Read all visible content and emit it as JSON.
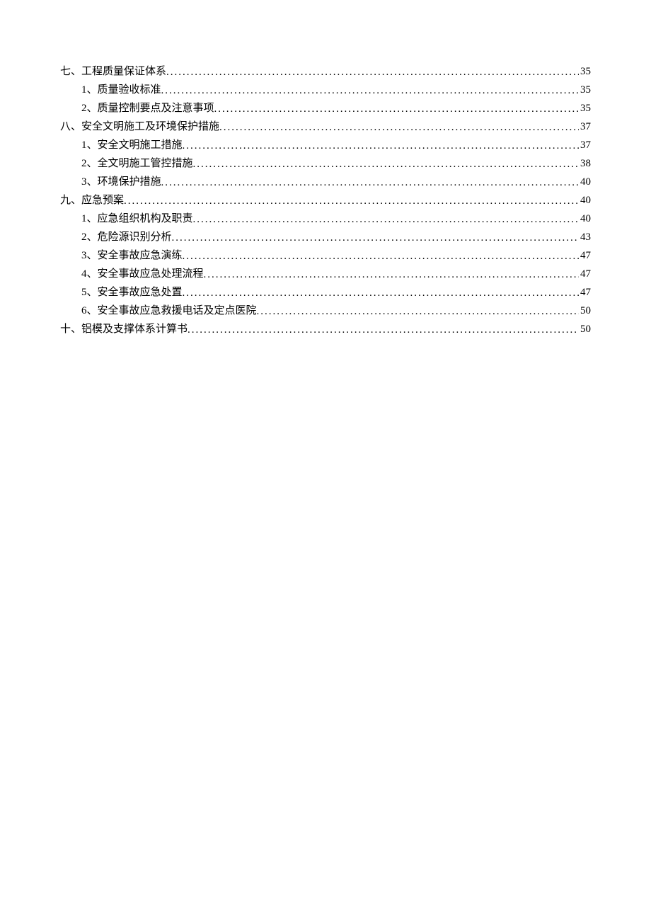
{
  "toc": [
    {
      "level": 1,
      "label": "七、工程质量保证体系",
      "page": "35"
    },
    {
      "level": 2,
      "label": "1、质量验收标准",
      "page": "35"
    },
    {
      "level": 2,
      "label": "2、质量控制要点及注意事项",
      "page": "35"
    },
    {
      "level": 1,
      "label": "八、安全文明施工及环境保护措施",
      "page": "37"
    },
    {
      "level": 2,
      "label": "1、安全文明施工措施",
      "page": "37"
    },
    {
      "level": 2,
      "label": "2、全文明施工管控措施",
      "page": "38"
    },
    {
      "level": 2,
      "label": "3、环境保护措施",
      "page": "40"
    },
    {
      "level": 1,
      "label": "九、应急预案",
      "page": "40"
    },
    {
      "level": 2,
      "label": "1、应急组织机构及职责",
      "page": "40"
    },
    {
      "level": 2,
      "label": "2、危险源识别分析",
      "page": "43"
    },
    {
      "level": 2,
      "label": "3、安全事故应急演练",
      "page": "47"
    },
    {
      "level": 2,
      "label": "4、安全事故应急处理流程",
      "page": "47"
    },
    {
      "level": 2,
      "label": "5、安全事故应急处置",
      "page": "47"
    },
    {
      "level": 2,
      "label": "6、安全事故应急救援电话及定点医院",
      "page": "50"
    },
    {
      "level": 1,
      "label": "十、铝模及支撑体系计算书",
      "page": "50"
    }
  ]
}
